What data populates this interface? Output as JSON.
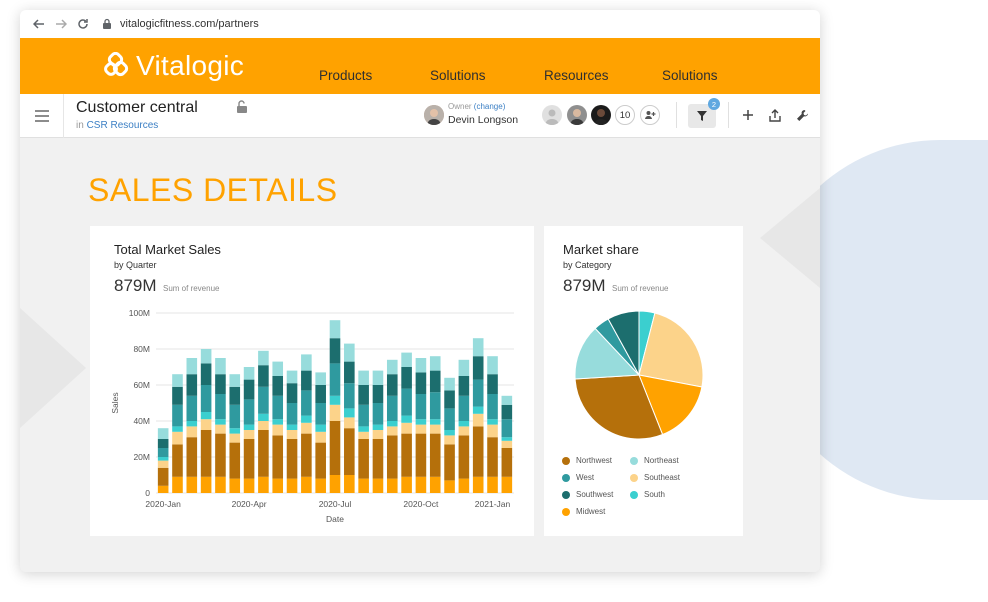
{
  "browser": {
    "url": "vitalogicfitness.com/partners"
  },
  "brand": {
    "name": "Vitalogic",
    "menu": [
      "Products",
      "Solutions",
      "Resources",
      "Solutions"
    ],
    "accent": "#ffa200"
  },
  "app_bar": {
    "title": "Customer central",
    "in_label": "in",
    "location": "CSR Resources",
    "owner_label": "Owner",
    "owner_change": "(change)",
    "owner_name": "Devin Longson",
    "collaborator_count": "10",
    "filter_count": "2"
  },
  "page": {
    "heading": "SALES DETAILS"
  },
  "sales_card": {
    "title": "Total Market Sales",
    "subtitle": "by Quarter",
    "metric": "879M",
    "metric_label": "Sum of revenue"
  },
  "share_card": {
    "title": "Market share",
    "subtitle": "by Category",
    "metric": "879M",
    "metric_label": "Sum of revenue"
  },
  "chart_data": [
    {
      "type": "bar",
      "stacked": true,
      "xlabel": "Date",
      "ylabel": "Sales",
      "ylim": [
        0,
        100
      ],
      "y_ticks": [
        "0",
        "20M",
        "40M",
        "60M",
        "80M",
        "100M"
      ],
      "x_ticks": [
        {
          "label": "2020-Jan",
          "index": 0
        },
        {
          "label": "2020-Apr",
          "index": 6
        },
        {
          "label": "2020-Jul",
          "index": 12
        },
        {
          "label": "2020-Oct",
          "index": 18
        },
        {
          "label": "2021-Jan",
          "index": 23
        }
      ],
      "grid": true,
      "series": [
        {
          "name": "Midwest",
          "color": "#ffa200",
          "values": [
            4,
            9,
            9,
            9,
            9,
            8,
            8,
            9,
            8,
            8,
            9,
            8,
            10,
            10,
            8,
            8,
            8,
            9,
            9,
            9,
            7,
            8,
            9,
            9,
            9
          ]
        },
        {
          "name": "Northwest",
          "color": "#b5700b",
          "values": [
            10,
            18,
            22,
            26,
            24,
            20,
            22,
            26,
            24,
            22,
            24,
            20,
            30,
            26,
            22,
            22,
            24,
            24,
            24,
            24,
            20,
            24,
            28,
            22,
            16
          ]
        },
        {
          "name": "Southeast",
          "color": "#fcd38a",
          "values": [
            4,
            7,
            6,
            6,
            5,
            5,
            5,
            5,
            6,
            5,
            6,
            6,
            9,
            6,
            4,
            5,
            5,
            6,
            5,
            5,
            5,
            5,
            7,
            7,
            4
          ]
        },
        {
          "name": "South",
          "color": "#3bcfcf",
          "values": [
            2,
            3,
            3,
            4,
            3,
            3,
            3,
            4,
            3,
            3,
            4,
            4,
            5,
            5,
            3,
            3,
            3,
            4,
            3,
            3,
            3,
            3,
            4,
            3,
            2
          ]
        },
        {
          "name": "West",
          "color": "#2f9a9f",
          "values": [
            5,
            12,
            14,
            15,
            14,
            13,
            14,
            15,
            13,
            12,
            14,
            12,
            18,
            14,
            12,
            12,
            14,
            15,
            14,
            15,
            12,
            14,
            15,
            14,
            10
          ]
        },
        {
          "name": "Southwest",
          "color": "#1c6e6e",
          "values": [
            5,
            10,
            12,
            12,
            11,
            10,
            11,
            12,
            11,
            11,
            11,
            10,
            14,
            12,
            11,
            10,
            12,
            12,
            12,
            12,
            10,
            11,
            13,
            11,
            8
          ]
        },
        {
          "name": "Northeast",
          "color": "#97dcdc",
          "values": [
            6,
            7,
            9,
            8,
            9,
            7,
            7,
            8,
            8,
            7,
            9,
            7,
            10,
            10,
            8,
            8,
            8,
            8,
            8,
            8,
            7,
            9,
            10,
            10,
            5
          ]
        }
      ]
    },
    {
      "type": "pie",
      "slices": [
        {
          "name": "Northwest",
          "color": "#b5700b",
          "value": 30
        },
        {
          "name": "West",
          "color": "#2f9a9f",
          "value": 4
        },
        {
          "name": "Southwest",
          "color": "#1c6e6e",
          "value": 8
        },
        {
          "name": "Midwest",
          "color": "#ffa200",
          "value": 16
        },
        {
          "name": "Northeast",
          "color": "#97dcdc",
          "value": 14
        },
        {
          "name": "Southeast",
          "color": "#fcd38a",
          "value": 24
        },
        {
          "name": "South",
          "color": "#3bcfcf",
          "value": 4
        }
      ],
      "slice_order": [
        "South",
        "Southeast",
        "Midwest",
        "Northwest",
        "Northeast",
        "West",
        "Southwest"
      ],
      "legend": [
        [
          "Northwest",
          "Northeast"
        ],
        [
          "West",
          "Southeast"
        ],
        [
          "Southwest",
          "South"
        ],
        [
          "Midwest"
        ]
      ]
    }
  ]
}
